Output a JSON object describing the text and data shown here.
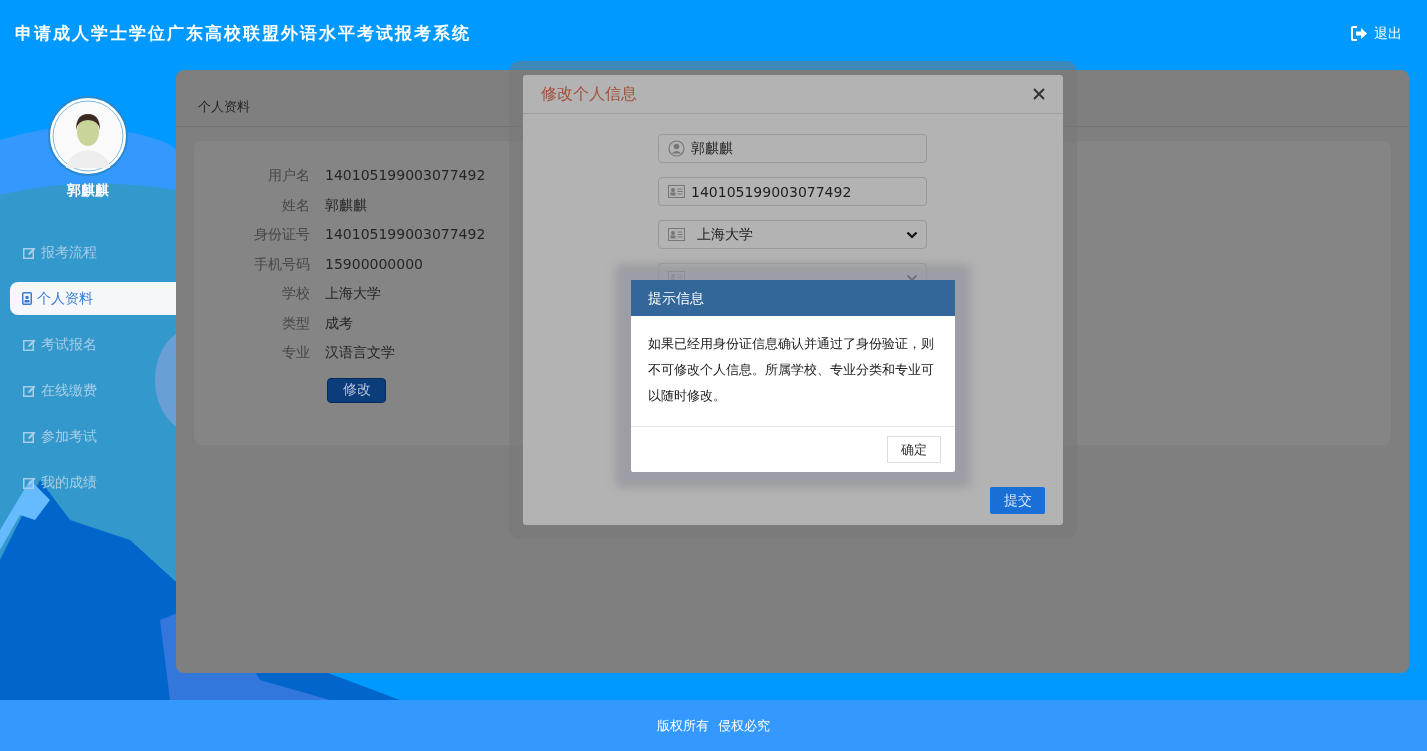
{
  "header": {
    "title": "申请成人学士学位广东高校联盟外语水平考试报考系统",
    "logout": "退出"
  },
  "user": {
    "name": "郭麒麒"
  },
  "menu": [
    {
      "label": "报考流程",
      "selected": false
    },
    {
      "label": "个人资料",
      "selected": true
    },
    {
      "label": "考试报名",
      "selected": false
    },
    {
      "label": "在线缴费",
      "selected": false
    },
    {
      "label": "参加考试",
      "selected": false
    },
    {
      "label": "我的成绩",
      "selected": false
    }
  ],
  "profile": {
    "title": "个人资料",
    "rows": [
      {
        "label": "用户名",
        "value": "140105199003077492"
      },
      {
        "label": "姓名",
        "value": "郭麒麒"
      },
      {
        "label": "身份证号",
        "value": "140105199003077492"
      },
      {
        "label": "手机号码",
        "value": "15900000000"
      },
      {
        "label": "学校",
        "value": "上海大学"
      },
      {
        "label": "类型",
        "value": "成考"
      },
      {
        "label": "专业",
        "value": "汉语言文学"
      }
    ],
    "edit_button": "修改"
  },
  "edit_modal": {
    "title": "修改个人信息",
    "fields": [
      {
        "kind": "text",
        "value": "郭麒麒"
      },
      {
        "kind": "text",
        "value": "140105199003077492"
      },
      {
        "kind": "select",
        "value": "上海大学"
      },
      {
        "kind": "select"
      }
    ],
    "submit": "提交"
  },
  "alert": {
    "title": "提示信息",
    "message": "如果已经用身份证信息确认并通过了身份验证，则不可修改个人信息。所属学校、专业分类和专业可以随时修改。",
    "confirm": "确定"
  },
  "footer": "版权所有  侵权必究"
}
